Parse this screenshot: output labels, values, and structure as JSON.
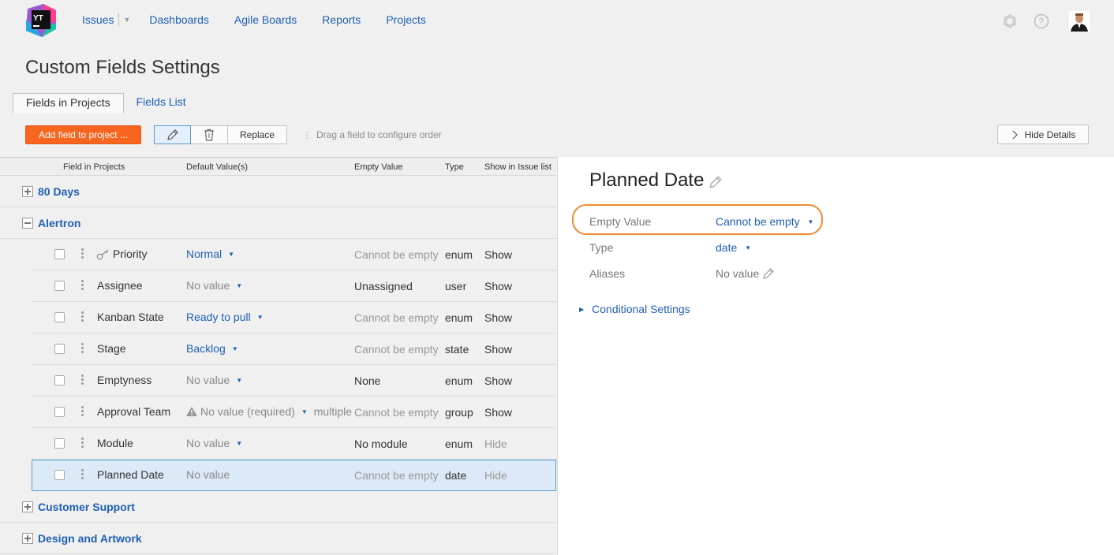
{
  "nav": {
    "issues": "Issues",
    "dashboards": "Dashboards",
    "agile_boards": "Agile Boards",
    "reports": "Reports",
    "projects": "Projects",
    "logo_text": "YT"
  },
  "page_title": "Custom Fields Settings",
  "tabs": {
    "fields_in_projects": "Fields in Projects",
    "fields_list": "Fields List"
  },
  "toolbar": {
    "add_field": "Add field to project ...",
    "replace": "Replace",
    "drag_hint": "Drag a field to configure order",
    "hide_details": "Hide Details"
  },
  "table": {
    "headers": {
      "field": "Field in Projects",
      "default": "Default Value(s)",
      "empty": "Empty Value",
      "type": "Type",
      "show": "Show in Issue list"
    },
    "groups": {
      "g80": "80 Days",
      "alertron": "Alertron",
      "customer_support": "Customer Support",
      "design": "Design and Artwork"
    },
    "rows": [
      {
        "name": "Priority",
        "default": "Normal",
        "empty": "Cannot be empty",
        "type": "enum",
        "show": "Show"
      },
      {
        "name": "Assignee",
        "default": "No value",
        "empty": "Unassigned",
        "type": "user",
        "show": "Show"
      },
      {
        "name": "Kanban State",
        "default": "Ready to pull",
        "empty": "Cannot be empty",
        "type": "enum",
        "show": "Show"
      },
      {
        "name": "Stage",
        "default": "Backlog",
        "empty": "Cannot be empty",
        "type": "state",
        "show": "Show"
      },
      {
        "name": "Emptyness",
        "default": "No value",
        "empty": "None",
        "type": "enum",
        "show": "Show"
      },
      {
        "name": "Approval Team",
        "default": "No value (required)",
        "multiple": "multiple",
        "empty": "Cannot be empty",
        "type": "group",
        "show": "Show"
      },
      {
        "name": "Module",
        "default": "No value",
        "empty": "No module",
        "type": "enum",
        "show": "Hide"
      },
      {
        "name": "Planned Date",
        "default": "No value",
        "empty": "Cannot be empty",
        "type": "date",
        "show": "Hide"
      }
    ]
  },
  "details": {
    "title": "Planned Date",
    "empty_value_label": "Empty Value",
    "empty_value": "Cannot be empty",
    "type_label": "Type",
    "type_value": "date",
    "aliases_label": "Aliases",
    "aliases_value": "No value",
    "conditional": "Conditional Settings"
  },
  "colors": {
    "accent": "#1f5fb5",
    "add_button": "#f7651f",
    "highlight": "#ef8a2e",
    "selected_row": "#dbeaf6"
  }
}
